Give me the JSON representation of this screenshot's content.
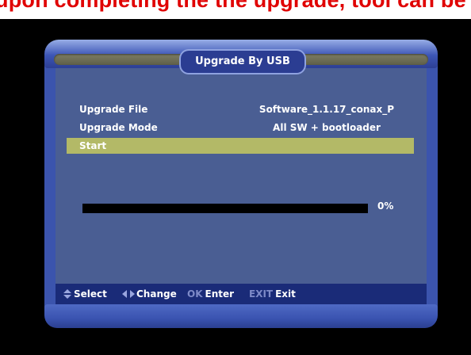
{
  "caption": {
    "text": "upon completing the the upgrade, tool can be used to"
  },
  "dialog": {
    "title": "Upgrade By USB",
    "rows": [
      {
        "label": "Upgrade File",
        "value": "Software_1.1.17_conax_P"
      },
      {
        "label": "Upgrade Mode",
        "value": "All SW + bootloader"
      },
      {
        "label": "Start",
        "value": ""
      }
    ],
    "progress": {
      "percent_label": "0%",
      "value": 0
    }
  },
  "help": {
    "select_label": "Select",
    "change_label": "Change",
    "ok_key": "OK",
    "enter_label": "Enter",
    "exit_key": "EXIT",
    "exit_label": "Exit"
  },
  "colors": {
    "caption": "#e00000",
    "panel": "#4a5e93",
    "highlight": "#b3b967",
    "frame": "#3b54ad"
  },
  "icons": {
    "select": "up-down-arrows-icon",
    "change": "left-right-arrows-icon"
  }
}
